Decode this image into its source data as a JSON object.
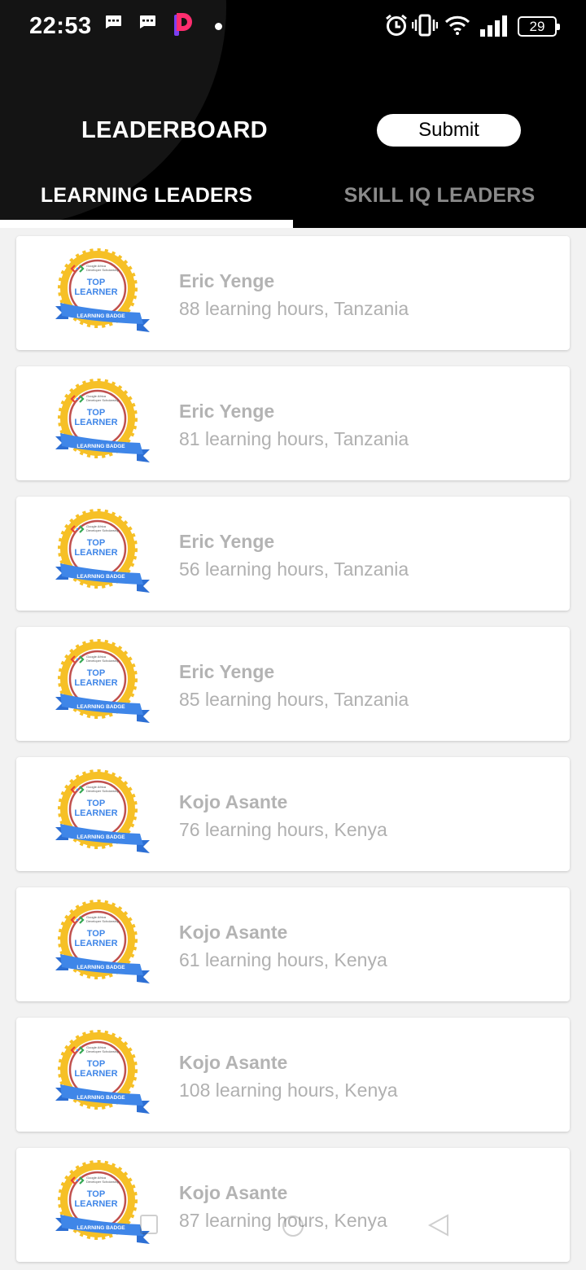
{
  "status_bar": {
    "time": "22:53",
    "battery": "29",
    "icons": [
      "message-icon",
      "message-icon",
      "p-app-icon",
      "dot-icon",
      "alarm-icon",
      "vibrate-icon",
      "wifi-icon",
      "signal-icon",
      "battery-icon"
    ]
  },
  "header": {
    "title": "LEADERBOARD",
    "submit_label": "Submit"
  },
  "tabs": [
    {
      "label": "LEARNING LEADERS",
      "active": true
    },
    {
      "label": "SKILL IQ LEADERS",
      "active": false
    }
  ],
  "badge": {
    "line1": "TOP",
    "line2": "LEARNER",
    "ribbon": "LEARNING BADGE",
    "org": "Google Africa Developer Scholarship"
  },
  "leaders": [
    {
      "name": "Eric Yenge",
      "detail": "88 learning hours, Tanzania"
    },
    {
      "name": "Eric Yenge",
      "detail": "81 learning hours, Tanzania"
    },
    {
      "name": "Eric Yenge",
      "detail": "56 learning hours, Tanzania"
    },
    {
      "name": "Eric Yenge",
      "detail": "85 learning hours, Tanzania"
    },
    {
      "name": "Kojo Asante",
      "detail": "76 learning hours, Kenya"
    },
    {
      "name": "Kojo Asante",
      "detail": "61 learning hours, Kenya"
    },
    {
      "name": "Kojo Asante",
      "detail": "108 learning hours, Kenya"
    },
    {
      "name": "Kojo Asante",
      "detail": "87 learning hours, Kenya"
    }
  ],
  "colors": {
    "header_bg": "#000000",
    "tab_inactive": "#8a8a8a",
    "badge_gold": "#f6c026",
    "badge_blue": "#3f86e8",
    "badge_ring": "#c0504d",
    "text_muted": "#b0b0b0"
  }
}
